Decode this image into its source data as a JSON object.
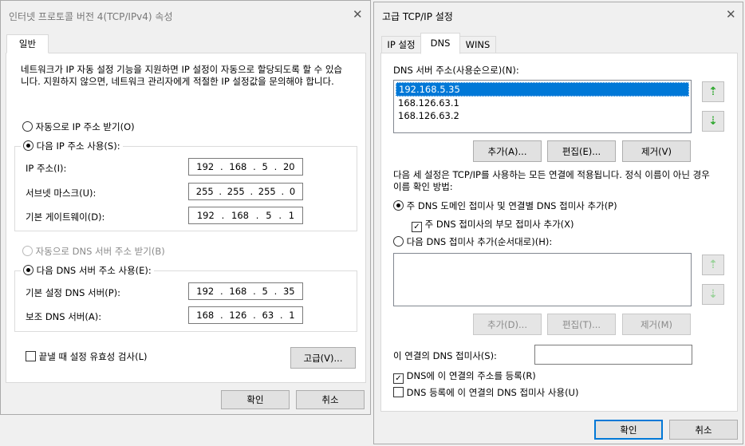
{
  "left_dialog": {
    "title": "인터넷 프로토콜 버전 4(TCP/IPv4) 속성",
    "tab_general": "일반",
    "intro": "네트워크가 IP 자동 설정 기능을 지원하면 IP 설정이 자동으로 할당되도록 할 수 있습니다. 지원하지 않으면, 네트워크 관리자에게 적절한 IP 설정값을 문의해야 합니다.",
    "auto_ip": "자동으로 IP 주소 받기(O)",
    "manual_ip": "다음 IP 주소 사용(S):",
    "ip_label": "IP 주소(I):",
    "ip": [
      "192",
      "168",
      "5",
      "20"
    ],
    "subnet_label": "서브넷 마스크(U):",
    "subnet": [
      "255",
      "255",
      "255",
      "0"
    ],
    "gateway_label": "기본 게이트웨이(D):",
    "gateway": [
      "192",
      "168",
      "5",
      "1"
    ],
    "auto_dns": "자동으로 DNS 서버 주소 받기(B)",
    "manual_dns": "다음 DNS 서버 주소 사용(E):",
    "pref_dns_label": "기본 설정 DNS 서버(P):",
    "pref_dns": [
      "192",
      "168",
      "5",
      "35"
    ],
    "alt_dns_label": "보조 DNS 서버(A):",
    "alt_dns": [
      "168",
      "126",
      "63",
      "1"
    ],
    "validate": "끝낼 때 설정 유효성 검사(L)",
    "advanced": "고급(V)...",
    "ok": "확인",
    "cancel": "취소"
  },
  "right_dialog": {
    "title": "고급 TCP/IP 설정",
    "tabs": [
      "IP 설정",
      "DNS",
      "WINS"
    ],
    "dns_servers_label": "DNS 서버 주소(사용순으로)(N):",
    "dns_servers": [
      "192.168.5.35",
      "168.126.63.1",
      "168.126.63.2"
    ],
    "add": "추가(A)...",
    "edit": "편집(E)...",
    "remove": "제거(V)",
    "desc": "다음 세 설정은 TCP/IP를 사용하는 모든 연결에 적용됩니다. 정식 이름이 아닌 경우 이름 확인 방법:",
    "append_primary": "주 DNS 도메인 접미사 및 연결별 DNS 접미사 추가(P)",
    "append_parent": "주 DNS 접미사의 부모 접미사 추가(X)",
    "append_these": "다음 DNS 접미사 추가(순서대로)(H):",
    "add2": "추가(D)...",
    "edit2": "편집(T)...",
    "remove2": "제거(M)",
    "conn_suffix_label": "이 연결의 DNS 접미사(S):",
    "conn_suffix": "",
    "register": "DNS에 이 연결의 주소를 등록(R)",
    "use_suffix": "DNS 등록에 이 연결의 DNS 접미사 사용(U)",
    "ok": "확인",
    "cancel": "취소"
  }
}
